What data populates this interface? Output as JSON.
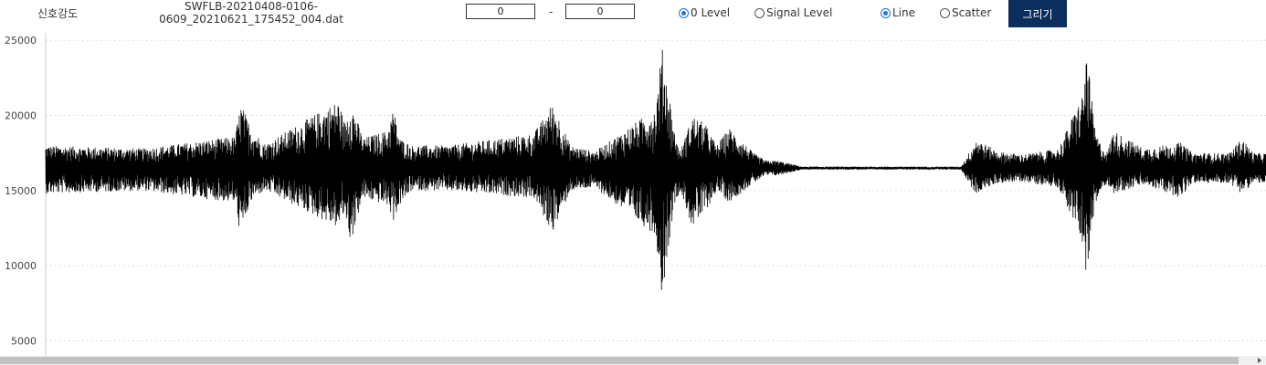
{
  "toolbar": {
    "signal_label": "신호강도",
    "filename_line1": "SWFLB-20210408-0106-",
    "filename_line2": "0609_20210621_175452_004.dat",
    "range_start": "0",
    "range_sep": "-",
    "range_end": "0",
    "level_options": [
      {
        "label": "0 Level",
        "selected": true
      },
      {
        "label": "Signal Level",
        "selected": false
      }
    ],
    "plot_options": [
      {
        "label": "Line",
        "selected": true
      },
      {
        "label": "Scatter",
        "selected": false
      }
    ],
    "draw_button": "그리기"
  },
  "colors": {
    "accent": "#0b2f5c",
    "radio_selected": "#1a73e8",
    "signal": "#000000",
    "grid": "#dddddd"
  },
  "chart_data": {
    "type": "line",
    "title": "",
    "xlabel": "",
    "ylabel": "",
    "ylim": [
      4000,
      25500
    ],
    "yticks": [
      5000,
      10000,
      15000,
      20000,
      25000
    ],
    "grid": "horizontal-dotted",
    "baseline": 16500,
    "envelope": {
      "x": [
        0,
        0.08,
        0.155,
        0.16,
        0.165,
        0.17,
        0.18,
        0.24,
        0.245,
        0.25,
        0.26,
        0.28,
        0.285,
        0.29,
        0.3,
        0.33,
        0.4,
        0.415,
        0.42,
        0.43,
        0.45,
        0.5,
        0.505,
        0.51,
        0.515,
        0.52,
        0.53,
        0.54,
        0.55,
        0.56,
        0.58,
        0.59,
        0.6,
        0.61,
        0.62,
        0.63,
        0.66,
        0.67,
        0.7,
        0.75,
        0.76,
        0.762,
        0.78,
        0.8,
        0.83,
        0.85,
        0.853,
        0.856,
        0.86,
        0.865,
        0.87,
        0.875,
        0.9,
        0.93,
        0.94,
        0.97,
        0.98,
        0.99,
        1.0
      ],
      "upper": [
        18000,
        17800,
        18600,
        20800,
        19800,
        19000,
        18100,
        21000,
        19500,
        21000,
        18500,
        19000,
        20500,
        18500,
        18000,
        18000,
        18800,
        20800,
        20000,
        18000,
        17600,
        20500,
        24600,
        22000,
        19000,
        17600,
        20000,
        19500,
        18000,
        19200,
        17500,
        17000,
        17000,
        16800,
        16600,
        16600,
        16600,
        16600,
        16600,
        16600,
        18000,
        18500,
        17600,
        17400,
        17800,
        21500,
        24400,
        22000,
        19000,
        18000,
        17600,
        19000,
        17800,
        18200,
        17500,
        17500,
        18500,
        17500,
        17500
      ],
      "lower": [
        14800,
        15000,
        14200,
        11800,
        13500,
        14500,
        15000,
        12500,
        13500,
        11500,
        14500,
        14000,
        13000,
        14000,
        15000,
        15000,
        14500,
        12200,
        13000,
        15000,
        15200,
        12000,
        7900,
        11000,
        14000,
        15000,
        12500,
        13500,
        15000,
        14200,
        15500,
        16000,
        16000,
        16200,
        16400,
        16400,
        16400,
        16400,
        16400,
        16400,
        15000,
        14800,
        15500,
        15600,
        15200,
        11500,
        9000,
        11000,
        14000,
        15000,
        15500,
        14800,
        15400,
        14500,
        15500,
        15500,
        14800,
        15500,
        15500
      ]
    }
  }
}
